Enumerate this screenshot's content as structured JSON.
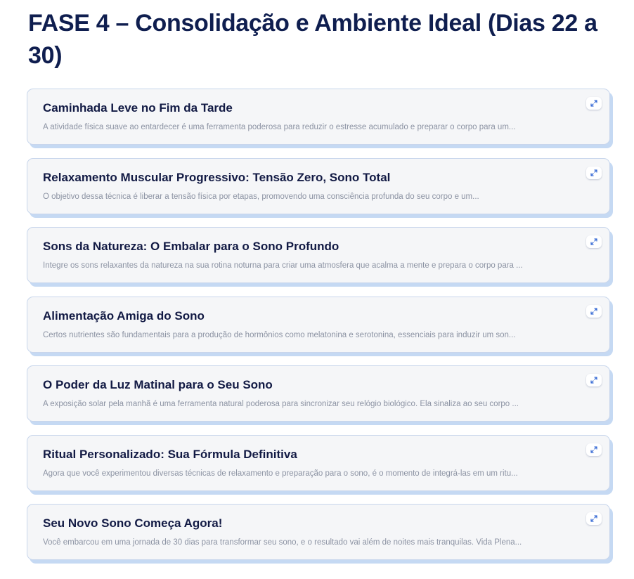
{
  "page": {
    "title": "FASE 4 – Consolidação e Ambiente Ideal (Dias 22 a 30)"
  },
  "cards": [
    {
      "title": "Caminhada Leve no Fim da Tarde",
      "description": "A atividade física suave ao entardecer é uma ferramenta poderosa para reduzir o estresse acumulado e preparar o corpo para um...",
      "icon": "expand-icon"
    },
    {
      "title": "Relaxamento Muscular Progressivo: Tensão Zero, Sono Total",
      "description": "O objetivo dessa técnica é liberar a tensão física por etapas, promovendo uma consciência profunda do seu corpo e um...",
      "icon": "expand-icon"
    },
    {
      "title": "Sons da Natureza: O Embalar para o Sono Profundo",
      "description": "Integre os sons relaxantes da natureza na sua rotina noturna para criar uma atmosfera que acalma a mente e prepara o corpo para ...",
      "icon": "expand-icon"
    },
    {
      "title": "Alimentação Amiga do Sono",
      "description": "Certos nutrientes são fundamentais para a produção de hormônios como melatonina e serotonina, essenciais para induzir um son...",
      "icon": "expand-icon"
    },
    {
      "title": "O Poder da Luz Matinal para o Seu Sono",
      "description": "A exposição solar pela manhã é uma ferramenta natural poderosa para sincronizar seu relógio biológico. Ela sinaliza ao seu corpo ...",
      "icon": "expand-icon"
    },
    {
      "title": "Ritual Personalizado: Sua Fórmula Definitiva",
      "description": "Agora que você experimentou diversas técnicas de relaxamento e preparação para o sono, é o momento de integrá-las em um ritu...",
      "icon": "expand-icon"
    },
    {
      "title": "Seu Novo Sono Começa Agora!",
      "description": "Você embarcou em uma jornada de 30 dias para transformar seu sono, e o resultado vai além de noites mais tranquilas. Vida Plena...",
      "icon": "expand-icon"
    }
  ],
  "colors": {
    "title": "#0f1e4f",
    "card_background": "#f5f6f8",
    "card_border": "#c8d6ec",
    "card_shadow": "#c5d9f3",
    "icon_accent": "#3d6fd6"
  }
}
